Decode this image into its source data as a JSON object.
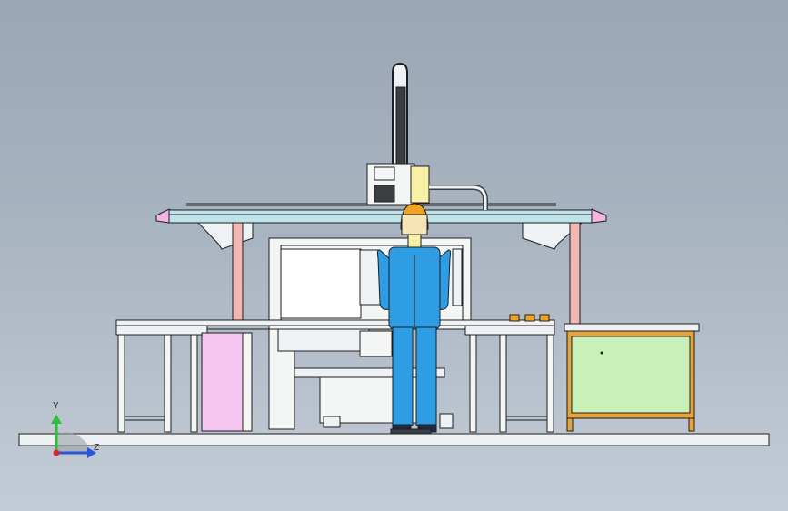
{
  "viewport": {
    "background_top": "#9aa6b5",
    "background_bottom": "#c3ccd6"
  },
  "colors": {
    "outline": "#1e1e1e",
    "table_plate": "#bfe3ea",
    "gantry_end": "#f3b4e6",
    "post": "#f1b7b3",
    "bracket": "#eef2f4",
    "machine_body": "#f4f6f6",
    "pink_panel": "#f6c6f2",
    "green_panel": "#c9f0b9",
    "orange_frame": "#e7a33b",
    "worker_blue": "#2e9de6",
    "helmet": "#f0a323",
    "visor": "#f6e3b6",
    "head_yellow": "#f7f0a6",
    "floor": "#eef1f3"
  },
  "triad": {
    "y_label": "Y",
    "z_label": "Z",
    "y_color": "#2bbf3a",
    "z_color": "#2a54d9",
    "x_color": "#d9262a"
  }
}
